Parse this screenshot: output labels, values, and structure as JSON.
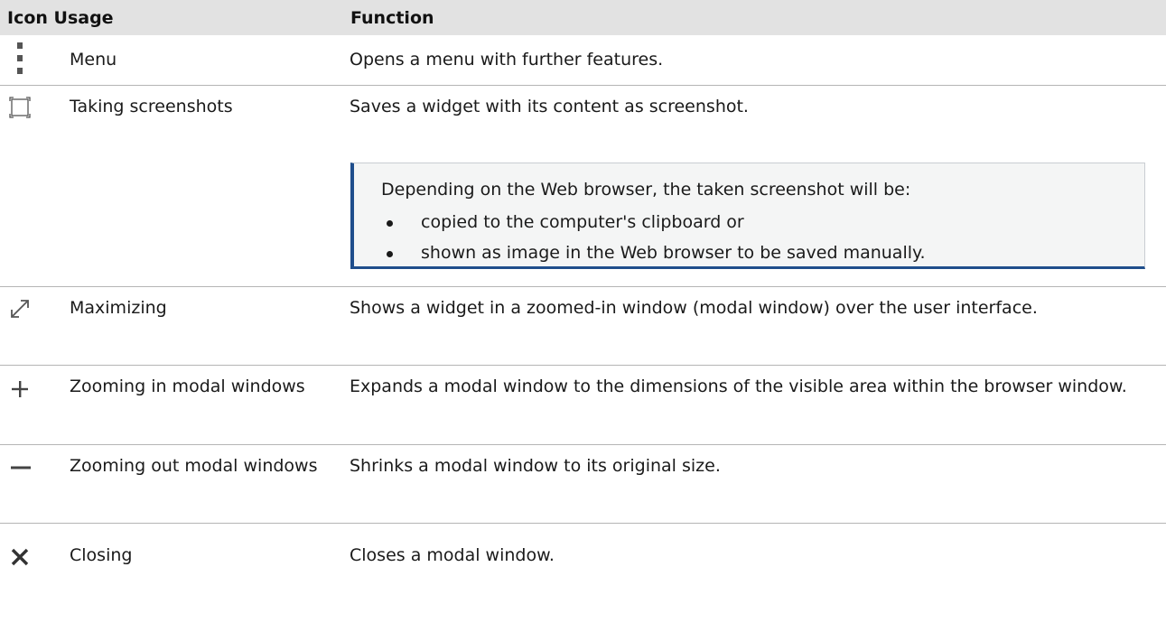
{
  "table": {
    "headers": {
      "icon_usage": "Icon Usage",
      "function": "Function"
    },
    "rows": [
      {
        "icon": "vertical-dots-icon",
        "usage": "Menu",
        "function": "Opens a menu with further features."
      },
      {
        "icon": "screenshot-frame-icon",
        "usage": "Taking screenshots",
        "function": "Saves a widget with its content as screenshot."
      },
      {
        "icon": "diagonal-expand-icon",
        "usage": "Maximizing",
        "function": "Shows a widget in a zoomed-in window (modal window) over the user interface."
      },
      {
        "icon": "plus-icon",
        "usage": "Zooming in modal windows",
        "function": "Expands a modal window to the dimensions of the visible area within the browser window."
      },
      {
        "icon": "minus-icon",
        "usage": "Zooming out modal windows",
        "function": "Shrinks a modal window to its original size."
      },
      {
        "icon": "close-x-icon",
        "usage": "Closing",
        "function": "Closes a modal window."
      }
    ],
    "note": {
      "intro": "Depending on the Web browser, the taken screenshot will be:",
      "items": [
        "copied to the computer's clipboard or",
        "shown as image in the Web browser to be saved manually."
      ],
      "accent_color": "#1f4e8c"
    }
  }
}
